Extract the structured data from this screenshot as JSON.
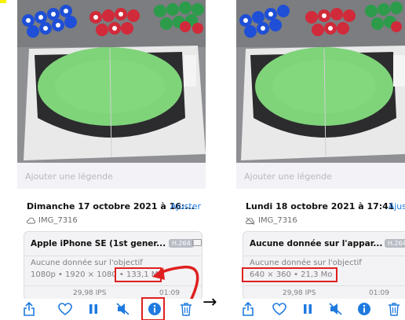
{
  "left": {
    "caption_placeholder": "Ajouter une légende",
    "date": "Dimanche 17 octobre 2021 à 16:...",
    "adjust_label": "Ajuster",
    "filename": "IMG_7316",
    "device": "Apple iPhone SE (1st gener...",
    "codec": "H.264",
    "lens_info": "Aucune donnée sur l'objectif",
    "specs": "1080p • 1920 × 1080 •",
    "file_size": "133,1 Mo",
    "fps": "29,98 IPS",
    "duration": "01:09"
  },
  "right": {
    "caption_placeholder": "Ajouter une légende",
    "date": "Lundi 18 octobre 2021 à 17:41",
    "adjust_label": "Ajus",
    "filename": "IMG_7316",
    "device": "Aucune donnée sur l'appar...",
    "codec": "H.264",
    "lens_info": "Aucune donnée sur l'objectif",
    "specs": "640 × 360 • 21,3 Mo",
    "fps": "29,98 IPS",
    "duration": "01:09"
  },
  "transition_arrow": "→",
  "toolbar_icons": [
    "share-icon",
    "heart-icon",
    "pause-icon",
    "mute-icon",
    "info-icon",
    "trash-icon"
  ],
  "colors": {
    "accent": "#1f7ae0",
    "highlight": "#e02020",
    "panel_bg": "#f2f2f7",
    "badge": "#b8bcc4"
  }
}
